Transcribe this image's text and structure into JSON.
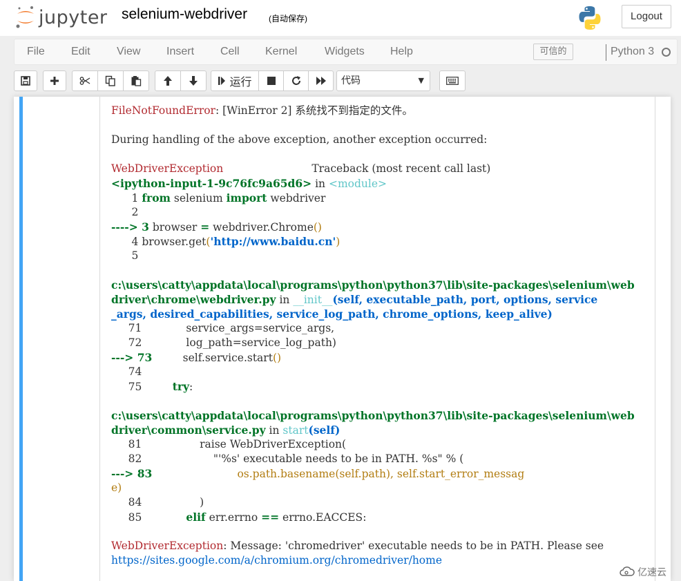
{
  "header": {
    "logo_text": "jupyter",
    "notebook_name": "selenium-webdriver",
    "autosave_status": "(自动保存)",
    "logout_label": "Logout"
  },
  "menubar": {
    "items": [
      "File",
      "Edit",
      "View",
      "Insert",
      "Cell",
      "Kernel",
      "Widgets",
      "Help"
    ],
    "trusted_label": "可信的",
    "kernel_name": "Python 3"
  },
  "toolbar": {
    "run_label": "运行",
    "cell_type_value": "代码"
  },
  "output": {
    "lines": [
      [
        {
          "t": "FileNotFoundError",
          "c": "red"
        },
        {
          "t": ": [WinError 2] 系统找不到指定的文件。"
        }
      ],
      [],
      [
        {
          "t": "During handling of the above exception, another exception occurred:"
        }
      ],
      [],
      [
        {
          "t": "WebDriverException",
          "c": "red"
        },
        {
          "t": "                          Traceback (most recent call last)"
        }
      ],
      [
        {
          "t": "<ipython-input-1-9c76fc9a65d6>",
          "c": "grn"
        },
        {
          "t": " in "
        },
        {
          "t": "<module>",
          "c": "cyan"
        }
      ],
      [
        {
          "t": "      1 "
        },
        {
          "t": "from",
          "c": "bgreen"
        },
        {
          "t": " selenium "
        },
        {
          "t": "import",
          "c": "bgreen"
        },
        {
          "t": " webdriver"
        }
      ],
      [
        {
          "t": "      2"
        }
      ],
      [
        {
          "t": "----> ",
          "c": "grn"
        },
        {
          "t": "3",
          "c": "grn"
        },
        {
          "t": " browser "
        },
        {
          "t": "=",
          "c": "bgreen"
        },
        {
          "t": " webdriver"
        },
        {
          "t": "."
        },
        {
          "t": "Chrome"
        },
        {
          "t": "()",
          "c": "yellow"
        }
      ],
      [
        {
          "t": "      4 "
        },
        {
          "t": "browser"
        },
        {
          "t": "."
        },
        {
          "t": "get"
        },
        {
          "t": "(",
          "c": "yellow"
        },
        {
          "t": "'http://www.baidu.cn'",
          "c": "bblue"
        },
        {
          "t": ")",
          "c": "yellow"
        }
      ],
      [
        {
          "t": "      5"
        }
      ],
      [],
      [
        {
          "t": "c:\\users\\catty\\appdata\\local\\programs\\python\\python37\\lib\\site-packages\\selenium\\web",
          "c": "grn"
        }
      ],
      [
        {
          "t": "driver\\chrome\\webdriver.py",
          "c": "grn"
        },
        {
          "t": " in "
        },
        {
          "t": "__init__",
          "c": "cyan"
        },
        {
          "t": "(self, executable_path, port, options, service",
          "c": "bblue"
        }
      ],
      [
        {
          "t": "_args, desired_capabilities, service_log_path, chrome_options, keep_alive)",
          "c": "bblue"
        }
      ],
      [
        {
          "t": "     71             service_args=service_args,"
        }
      ],
      [
        {
          "t": "     72             log_path=service_log_path)"
        }
      ],
      [
        {
          "t": "---> ",
          "c": "grn"
        },
        {
          "t": "73",
          "c": "grn"
        },
        {
          "t": "         self"
        },
        {
          "t": "."
        },
        {
          "t": "service"
        },
        {
          "t": "."
        },
        {
          "t": "start"
        },
        {
          "t": "()",
          "c": "yellow"
        }
      ],
      [
        {
          "t": "     74"
        }
      ],
      [
        {
          "t": "     75         "
        },
        {
          "t": "try",
          "c": "bgreen"
        },
        {
          "t": ":"
        }
      ],
      [],
      [
        {
          "t": "c:\\users\\catty\\appdata\\local\\programs\\python\\python37\\lib\\site-packages\\selenium\\web",
          "c": "grn"
        }
      ],
      [
        {
          "t": "driver\\common\\service.py",
          "c": "grn"
        },
        {
          "t": " in "
        },
        {
          "t": "start",
          "c": "cyan"
        },
        {
          "t": "(self)",
          "c": "bblue"
        }
      ],
      [
        {
          "t": "     81                 raise WebDriverException("
        }
      ],
      [
        {
          "t": "     82                     \"'%s' executable needs to be in PATH. %s\" % ("
        }
      ],
      [
        {
          "t": "---> ",
          "c": "grn"
        },
        {
          "t": "83",
          "c": "grn"
        },
        {
          "t": "                         os.path.basename(self.path), self.start_error_messag",
          "c": "yellow"
        }
      ],
      [
        {
          "t": "e)",
          "c": "yellow"
        }
      ],
      [
        {
          "t": "     84                 )"
        }
      ],
      [
        {
          "t": "     85             "
        },
        {
          "t": "elif",
          "c": "bgreen"
        },
        {
          "t": " err"
        },
        {
          "t": "."
        },
        {
          "t": "errno "
        },
        {
          "t": "==",
          "c": "bgreen"
        },
        {
          "t": " errno"
        },
        {
          "t": "."
        },
        {
          "t": "EACCES"
        },
        {
          "t": ":"
        }
      ],
      [],
      [
        {
          "t": "WebDriverException",
          "c": "red"
        },
        {
          "t": ": Message: 'chromedriver' executable needs to be in PATH. Please see"
        }
      ],
      [
        {
          "t": "https://sites.google.com/a/chromium.org/chromedriver/home",
          "c": "blue"
        }
      ]
    ]
  },
  "watermark": "亿速云",
  "colors": {
    "cell_bar": "#42a5f5",
    "error_red": "#b22b31",
    "trace_green": "#007427",
    "module_cyan": "#60c6c8"
  }
}
